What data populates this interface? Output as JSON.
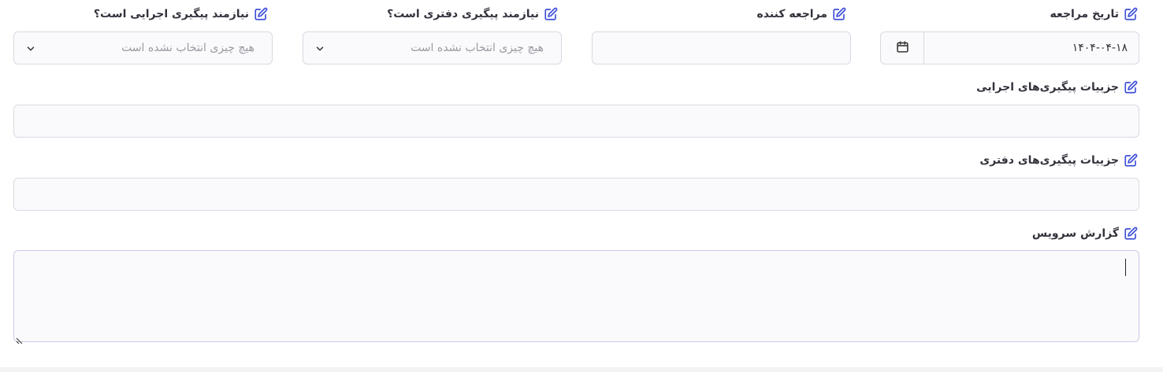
{
  "fields": {
    "visit_date": {
      "label": "تاریخ مراجعه",
      "value": "۱۴۰۴-۰۴-۱۸"
    },
    "visitor": {
      "label": "مراجعه کننده",
      "value": ""
    },
    "office_followup": {
      "label": "نیازمند پیگیری دفتری است؟",
      "placeholder": "هیچ چیزی انتخاب نشده است"
    },
    "exec_followup": {
      "label": "نیازمند پیگیری اجرایی است؟",
      "placeholder": "هیچ چیزی انتخاب نشده است"
    },
    "exec_details": {
      "label": "جزییات پیگیری‌های اجرایی",
      "value": ""
    },
    "office_details": {
      "label": "جزییات پیگیری‌های دفتری",
      "value": ""
    },
    "service_report": {
      "label": "گزارش سرویس",
      "value": ""
    }
  },
  "icons": {
    "edit": "edit-icon",
    "calendar": "calendar-icon",
    "dropdown": "chevron-down-icon"
  },
  "colors": {
    "accent": "#3d4fd8",
    "border": "#d9d9e2",
    "field_bg": "#fafafc"
  }
}
